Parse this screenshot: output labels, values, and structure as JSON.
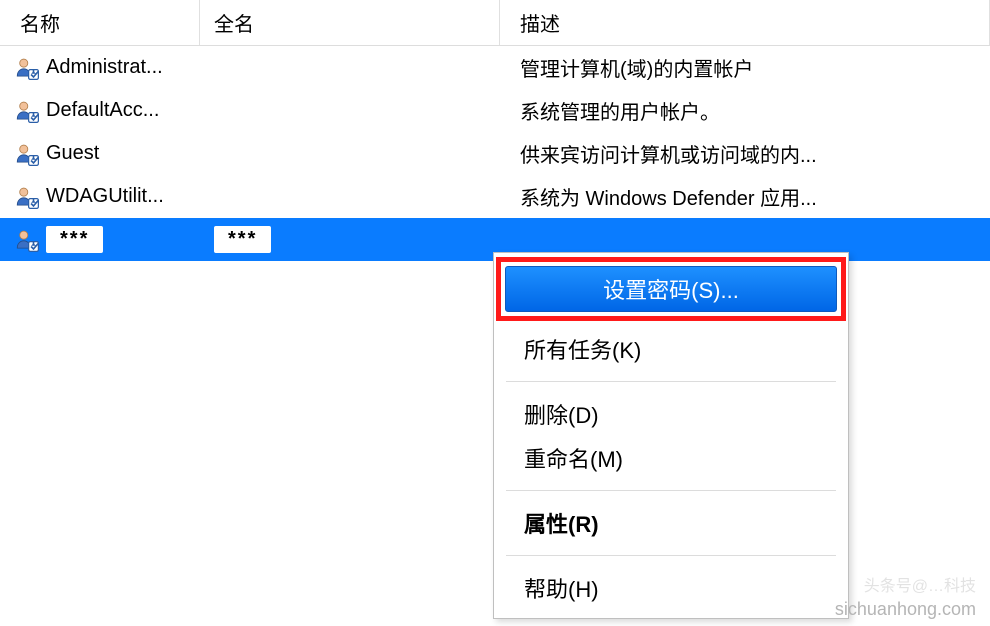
{
  "columns": {
    "name": "名称",
    "fullname": "全名",
    "description": "描述"
  },
  "rows": [
    {
      "name": "Administrat...",
      "fullname": "",
      "description": "管理计算机(域)的内置帐户",
      "redacted": false
    },
    {
      "name": "DefaultAcc...",
      "fullname": "",
      "description": "系统管理的用户帐户。",
      "redacted": false
    },
    {
      "name": "Guest",
      "fullname": "",
      "description": "供来宾访问计算机或访问域的内...",
      "redacted": false
    },
    {
      "name": "WDAGUtilit...",
      "fullname": "",
      "description": "系统为 Windows Defender 应用...",
      "redacted": false
    },
    {
      "name": "***",
      "fullname": "***",
      "description": "",
      "redacted": true,
      "selected": true
    }
  ],
  "context_menu": {
    "set_password": "设置密码(S)...",
    "all_tasks": "所有任务(K)",
    "delete": "删除(D)",
    "rename": "重命名(M)",
    "properties": "属性(R)",
    "help": "帮助(H)"
  },
  "watermark_top": "头条号@…科技",
  "watermark": "sichuanhong.com"
}
